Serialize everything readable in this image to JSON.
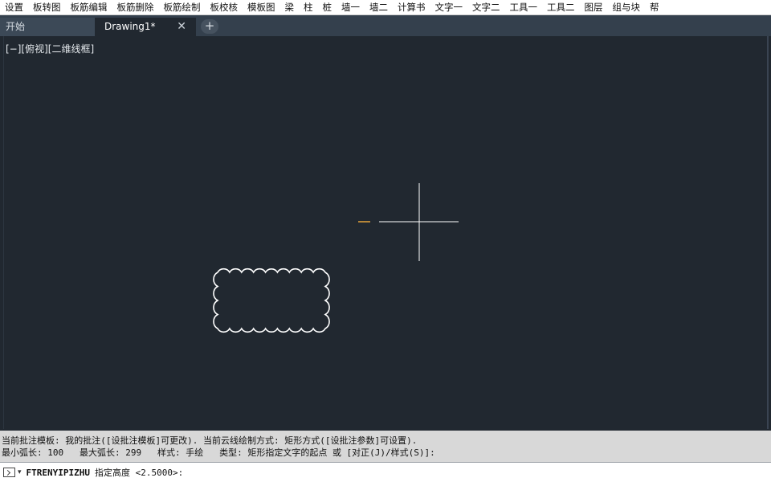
{
  "menu": {
    "items": [
      "设置",
      "板转图",
      "板筋编辑",
      "板筋删除",
      "板筋绘制",
      "板校核",
      "模板图",
      "梁",
      "柱",
      "桩",
      "墙一",
      "墙二",
      "计算书",
      "文字一",
      "文字二",
      "工具一",
      "工具二",
      "图层",
      "组与块",
      "帮"
    ]
  },
  "tabs": {
    "start": "开始",
    "drawing": "Drawing1*",
    "close": "✕",
    "add": "+"
  },
  "viewport": {
    "label": "[−][俯视][二维线框]",
    "background": "#212830",
    "cursor_color": "#ffffff",
    "snap_marker_color": "#e7a43a",
    "cloud_color": "#ffffff"
  },
  "history": {
    "line1": "当前批注模板: 我的批注([设批注模板]可更改). 当前云线绘制方式: 矩形方式([设批注参数]可设置).",
    "line2": "最小弧长: 100   最大弧长: 299   样式: 手绘   类型: 矩形指定文字的起点 或 [对正(J)/样式(S)]:"
  },
  "command": {
    "dropdown": "▾",
    "name": "FTRENYIPIZHU",
    "prompt": "指定高度 <2.5000>:"
  }
}
